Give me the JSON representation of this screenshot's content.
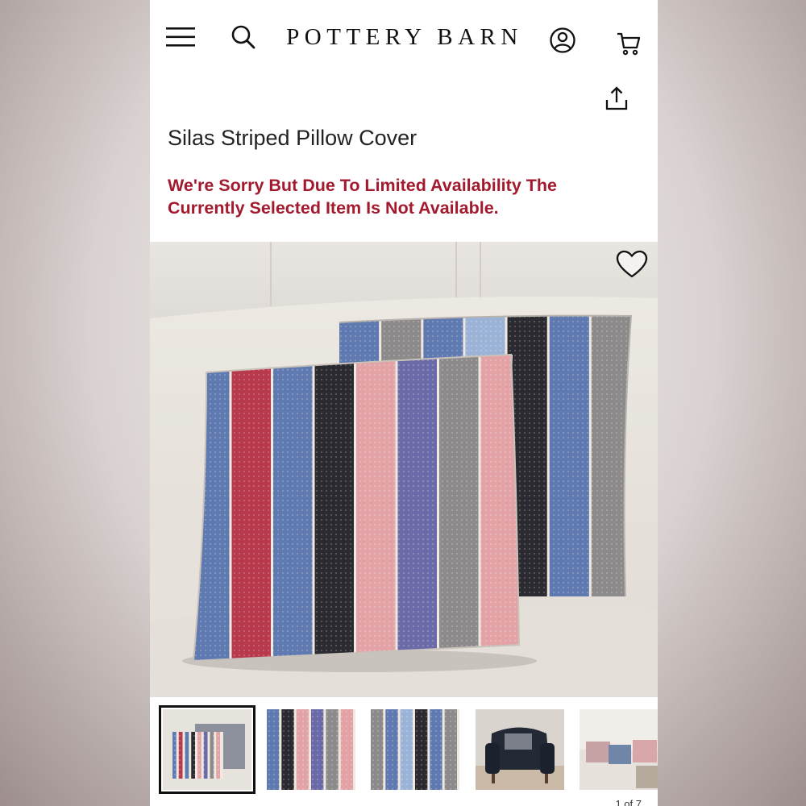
{
  "header": {
    "brand": "POTTERY BARN",
    "menu_icon": "hamburger-menu-icon",
    "search_icon": "search-icon",
    "account_icon": "account-icon",
    "cart_icon": "cart-icon",
    "share_icon": "share-icon"
  },
  "product": {
    "title": "Silas Striped Pillow Cover",
    "availability_message": "We're Sorry But Due To Limited Availability The Currently Selected Item Is Not Available."
  },
  "gallery": {
    "favorite_icon": "heart-icon",
    "thumbnails": [
      {
        "name": "thumbnail-pillow-pair",
        "selected": true
      },
      {
        "name": "thumbnail-front-detail",
        "selected": false
      },
      {
        "name": "thumbnail-back-detail",
        "selected": false
      },
      {
        "name": "thumbnail-armchair",
        "selected": false
      },
      {
        "name": "thumbnail-sofa-room",
        "selected": false
      }
    ],
    "pager_text": "1 of 7"
  },
  "colors": {
    "availability_text": "#a3192d",
    "stripe_red": "#b8394c",
    "stripe_blue": "#5f7ab0",
    "stripe_black": "#2b2a30",
    "stripe_pink": "#e3a3a6",
    "stripe_purple": "#6b6aa8",
    "stripe_gray": "#8d8a8c"
  }
}
